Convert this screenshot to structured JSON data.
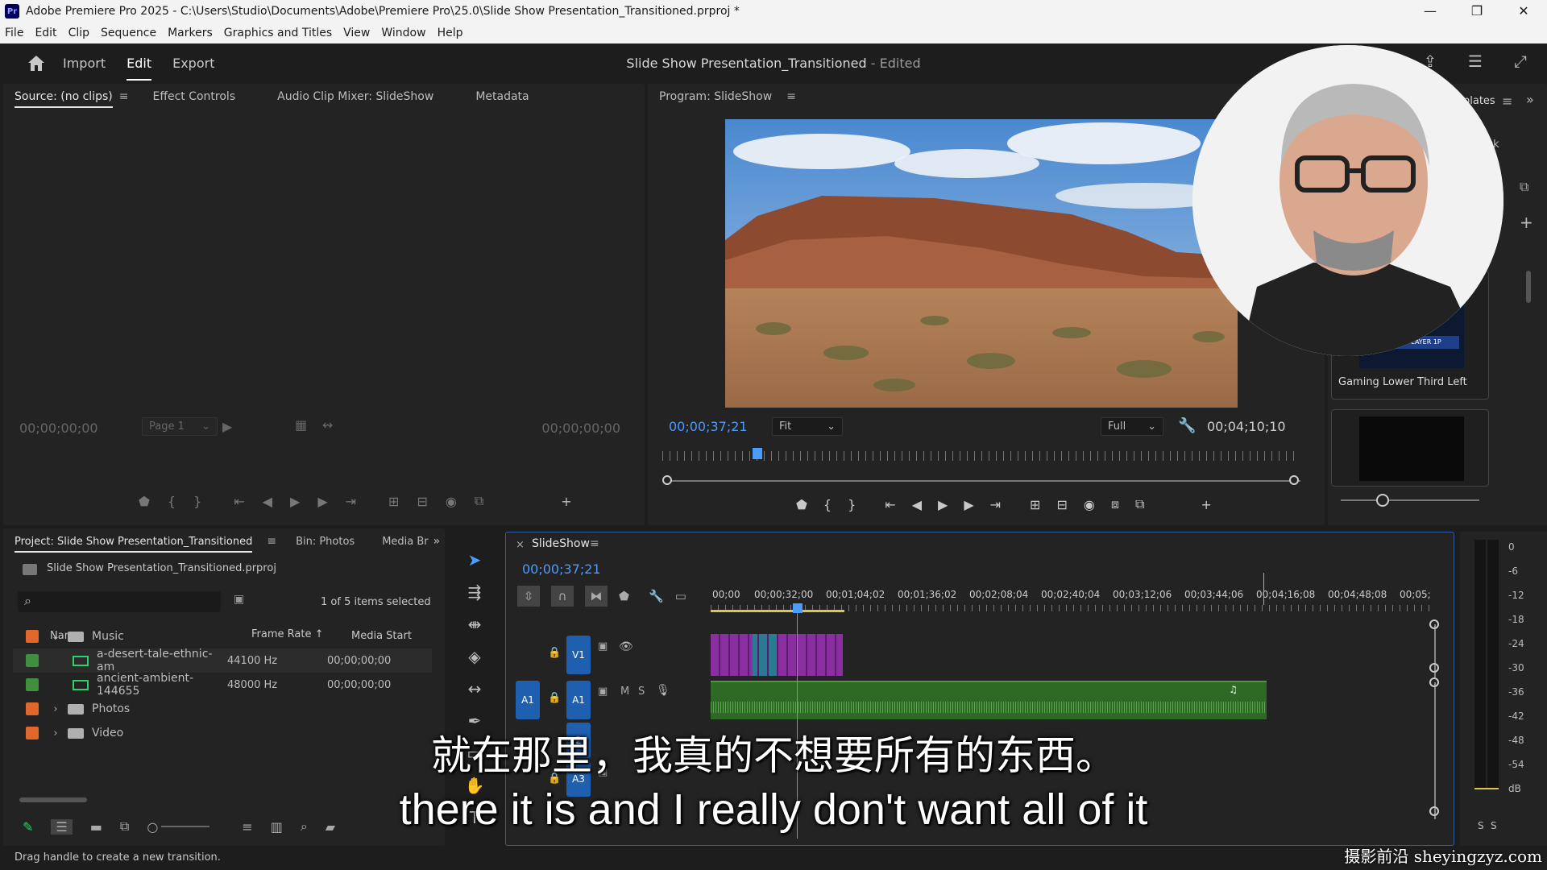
{
  "window": {
    "title": "Adobe Premiere Pro 2025 - C:\\Users\\Studio\\Documents\\Adobe\\Premiere Pro\\25.0\\Slide Show Presentation_Transitioned.prproj *",
    "app_icon": "Pr",
    "minimize": "—",
    "maximize": "❐",
    "close": "✕"
  },
  "menu": [
    "File",
    "Edit",
    "Clip",
    "Sequence",
    "Markers",
    "Graphics and Titles",
    "View",
    "Window",
    "Help"
  ],
  "header": {
    "tabs": [
      "Import",
      "Edit",
      "Export"
    ],
    "active_tab": "Edit",
    "project_title": "Slide Show Presentation_Transitioned",
    "project_status": "- Edited"
  },
  "source_panel": {
    "tabs": [
      "Source: (no clips)",
      "Effect Controls",
      "Audio Clip Mixer: SlideShow",
      "Metadata"
    ],
    "timecode_in": "00;00;00;00",
    "timecode_out": "00;00;00;00",
    "page_select": "Page 1"
  },
  "program_panel": {
    "tab": "Program: SlideShow",
    "timecode": "00;00;37;21",
    "fit": "Fit",
    "quality": "Full",
    "duration": "00;04;10;10"
  },
  "essential_graphics": {
    "tab_partial": "plates",
    "lock_partial": "ock",
    "template_name": "Gaming Lower Third Left",
    "thumb_text": "READY PLAYER 1P"
  },
  "project_panel": {
    "tabs": [
      "Project: Slide Show Presentation_Transitioned",
      "Bin: Photos",
      "Media Br"
    ],
    "file": "Slide Show Presentation_Transitioned.prproj",
    "search_placeholder": "",
    "selection": "1 of 5 items selected",
    "columns": [
      "Name",
      "Frame Rate",
      "Media Start"
    ],
    "rows": [
      {
        "name": "Music",
        "type": "folder",
        "expanded": true,
        "color": "#e0672b",
        "frame_rate": "",
        "media_start": ""
      },
      {
        "name": "a-desert-tale-ethnic-am",
        "type": "audio",
        "color": "#3f8f3f",
        "frame_rate": "44100 Hz",
        "media_start": "00;00;00;00"
      },
      {
        "name": "ancient-ambient-144655",
        "type": "audio",
        "color": "#3f8f3f",
        "frame_rate": "48000 Hz",
        "media_start": "00;00;00;00"
      },
      {
        "name": "Photos",
        "type": "folder",
        "expanded": false,
        "color": "#e0672b",
        "frame_rate": "",
        "media_start": ""
      },
      {
        "name": "Video",
        "type": "folder",
        "expanded": false,
        "color": "#e0672b",
        "frame_rate": "",
        "media_start": ""
      }
    ]
  },
  "timeline": {
    "tab": "SlideShow",
    "close": "×",
    "timecode": "00;00;37;21",
    "ruler": [
      "00;00",
      "00;00;32;00",
      "00;01;04;02",
      "00;01;36;02",
      "00;02;08;04",
      "00;02;40;04",
      "00;03;12;06",
      "00;03;44;06",
      "00;04;16;08",
      "00;04;48;08",
      "00;05;"
    ],
    "tracks": {
      "v1": "V1",
      "a1_source": "A1",
      "a1": "A1",
      "a2": "2",
      "a3": "A3",
      "mute": "M",
      "solo": "S"
    }
  },
  "meter": {
    "scale": [
      "0",
      "-6",
      "-12",
      "-18",
      "-24",
      "-30",
      "-36",
      "-42",
      "-48",
      "-54",
      "dB"
    ],
    "channels": [
      "S",
      "S"
    ]
  },
  "subtitles": {
    "chinese": "就在那里，我真的不想要所有的东西。",
    "english": "there it is and I really don't want all of it"
  },
  "status": "Drag handle to create a new transition.",
  "watermark": "摄影前沿 sheyingzyz.com"
}
